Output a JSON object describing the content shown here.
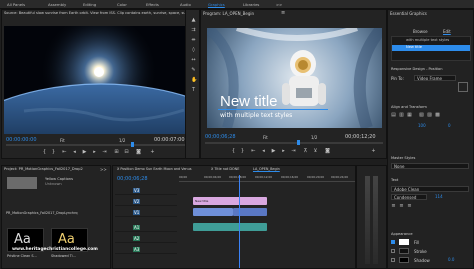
{
  "topbar": {
    "workspaces": [
      "All Panels",
      "Assembly",
      "Editing",
      "Color",
      "Effects",
      "Audio",
      "Graphics",
      "Libraries"
    ],
    "active_workspace": "Graphics",
    "overflow": ">>"
  },
  "source": {
    "title": "Source: Beautiful slow sunrise from Earth orbit. View from ISS. Clip contains earth, sunrise, space, sun, st",
    "timecode_in": "00:00:00:00",
    "fit": "Fit",
    "ratio": "1/2",
    "timecode_dur": "00:00:07:00"
  },
  "program": {
    "title": "Program: LA_OPEN_Begin",
    "menu_icon": "≡",
    "overlay_title": "New title",
    "overlay_subtitle": "with multiple text styles",
    "timecode_in": "00;00;06;28",
    "fit": "Fit",
    "ratio": "1/2",
    "timecode_dur": "00;00;12;20"
  },
  "essential": {
    "title": "Essential Graphics",
    "tabs": [
      "Browse",
      "Edit"
    ],
    "active_tab": "Edit",
    "layers": [
      "with multiple text styles",
      "New title"
    ],
    "responsive_label": "Responsive Design - Position",
    "pin_to_label": "Pin To:",
    "pin_to_value": "Video Frame",
    "align_label": "Align and Transform",
    "transform_value": "100",
    "transform_rot": "0",
    "master_styles_label": "Master Styles",
    "master_styles_value": "None",
    "text_label": "Text",
    "font": "Adobe Clean",
    "font_style": "Condensed",
    "font_size": "114",
    "appearance_label": "Appearance",
    "fill_label": "Fill",
    "stroke_label": "Stroke",
    "shadow_label": "Shadow",
    "shadow_value": "0.0"
  },
  "project": {
    "title": "Project: PR_MotionGraphics_Fall2017_Drop2",
    "tab_overflow": ">>",
    "file_name": "PR_MotionGraphics_Fall2017_DropLynchrq",
    "item_caption": "Yellow Captions",
    "item_caption_sub": "Unknown",
    "thumb1_text": "Aa",
    "thumb1_label": "Pristine Clean S...",
    "thumb2_text": "Aa",
    "thumb2_label": "Shadowed Ti...",
    "watermark": "www.heritagechristiancollege.com"
  },
  "timeline": {
    "tabs": [
      "X Position Demo Sun Earth Moon and Venus",
      "X Title not DONE",
      "LA_OPEN_Begin"
    ],
    "active_tab": "LA_OPEN_Begin",
    "timecode": "00;00;06;28",
    "ruler": [
      "00;00",
      "00;00;04;00",
      "00;00;08;00",
      "00;00;12;00",
      "00;00;16;00",
      "00;00;20;00",
      "00;00;24;00"
    ],
    "tracks": [
      "V3",
      "V2",
      "V1",
      "A1",
      "A2",
      "A3"
    ],
    "clip_label": "New title"
  },
  "colors": {
    "accent": "#2d8ceb",
    "clip_pink": "#d9a8e0",
    "clip_blue": "#6f8fd8",
    "clip_teal": "#3f9d97",
    "playhead": "#3b82f6"
  }
}
